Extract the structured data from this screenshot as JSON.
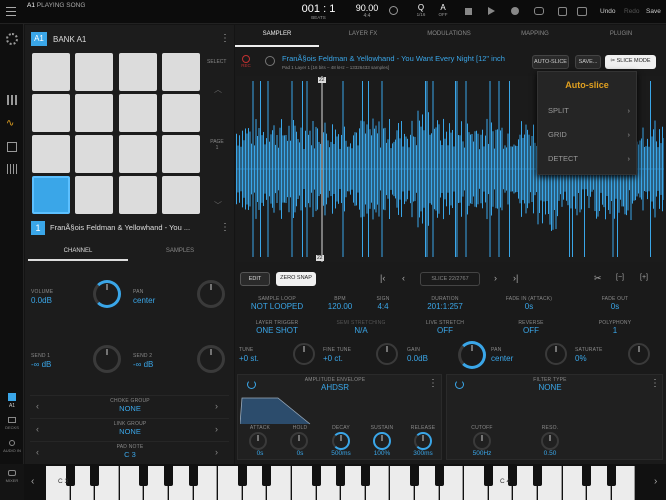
{
  "topbar": {
    "song_prefix": "A1",
    "song_label": "PLAYING SONG",
    "bar": "001 : 1",
    "bar_sub": "BEATS",
    "tempo": "90.00",
    "tempo_sub": "4:4",
    "quant": "Q",
    "quant_sub": "1/16",
    "key": "A",
    "key_sub": "OFF",
    "undo": "Undo",
    "redo": "Redo",
    "save": "Save"
  },
  "bank": {
    "badge": "A1",
    "title": "BANK A1",
    "select": "SELECT",
    "page_label": "PAGE",
    "page_num": "1"
  },
  "pad_info": {
    "number": "1",
    "name": "FranÃ§ois Feldman & Yellowhand - You ..."
  },
  "left_tabs": [
    "CHANNEL",
    "SAMPLES"
  ],
  "channel": {
    "volume_label": "VOLUME",
    "volume_value": "0.0dB",
    "pan_label": "PAN",
    "pan_value": "center",
    "send1_label": "SEND 1",
    "send1_value": "-∞ dB",
    "send2_label": "SEND 2",
    "send2_value": "-∞ dB"
  },
  "rows": [
    {
      "label": "CHOKE GROUP",
      "value": "NONE"
    },
    {
      "label": "LINK GROUP",
      "value": "NONE"
    },
    {
      "label": "PAD NOTE",
      "value": "C 3"
    }
  ],
  "side_bottom": [
    "A1",
    "DECKS",
    "AUDIO IN",
    "MIXER"
  ],
  "tabs": [
    "SAMPLER",
    "LAYER FX",
    "MODULATIONS",
    "MAPPING",
    "PLUGIN"
  ],
  "sample": {
    "rec": "REC",
    "title": "FranÃ§ois Feldman & Yellowhand - You Want Every Night [12\" inch",
    "meta": "Pad 1    Layer 1    [16 bits – 48 kHz – 13326433 samples]",
    "auto_slice": "AUTO-SLICE",
    "save": "SAVE...",
    "slice_mode": "SLICE MODE",
    "marker_top": "22",
    "marker_bottom": "22"
  },
  "autoslice_menu": {
    "title": "Auto-slice",
    "items": [
      "SPLIT",
      "GRID",
      "DETECT"
    ]
  },
  "wave_toolbar": {
    "edit": "EDIT",
    "zero_snap": "ZERO SNAP",
    "slice": "SLICE 22/2767",
    "minus": "[−]",
    "plus": "[+]"
  },
  "params1": [
    {
      "label": "SAMPLE LOOP",
      "value": "NOT LOOPED"
    },
    {
      "label": "BPM",
      "value": "120.00"
    },
    {
      "label": "SIGN",
      "value": "4:4"
    },
    {
      "label": "DURATION",
      "value": "201:1:257"
    },
    {
      "label": "FADE IN (ATTACK)",
      "value": "0s"
    },
    {
      "label": "FADE OUT",
      "value": "0s"
    }
  ],
  "params2": [
    {
      "label": "LAYER TRIGGER",
      "value": "ONE SHOT"
    },
    {
      "label": "SEMI STRETCHING",
      "value": "N/A"
    },
    {
      "label": "LIVE STRETCH",
      "value": "OFF"
    },
    {
      "label": "REVERSE",
      "value": "OFF"
    },
    {
      "label": "POLYPHONY",
      "value": "1"
    }
  ],
  "knobs": [
    {
      "label": "TUNE",
      "value": "+0 st."
    },
    {
      "label": "FINE TUNE",
      "value": "+0 ct."
    },
    {
      "label": "GAIN",
      "value": "0.0dB"
    },
    {
      "label": "PAN",
      "value": "center"
    },
    {
      "label": "SATURATE",
      "value": "0%"
    }
  ],
  "amp": {
    "label": "AMPLITUDE ENVELOPE",
    "value": "AHDSR",
    "knobs": [
      {
        "label": "ATTACK",
        "value": "0s"
      },
      {
        "label": "HOLD",
        "value": "0s"
      },
      {
        "label": "DECAY",
        "value": "500ms"
      },
      {
        "label": "SUSTAIN",
        "value": "100%"
      },
      {
        "label": "RELEASE",
        "value": "300ms"
      }
    ]
  },
  "filter": {
    "label": "FILTER TYPE",
    "value": "NONE",
    "knobs": [
      {
        "label": "CUTOFF",
        "value": "500Hz"
      },
      {
        "label": "RESO.",
        "value": "0.50"
      }
    ]
  },
  "keyboard": {
    "c3": "C 3",
    "c4": "C 4"
  },
  "colors": {
    "accent": "#3aa6e8",
    "background": "#141414",
    "panel": "#1e1e1e"
  }
}
